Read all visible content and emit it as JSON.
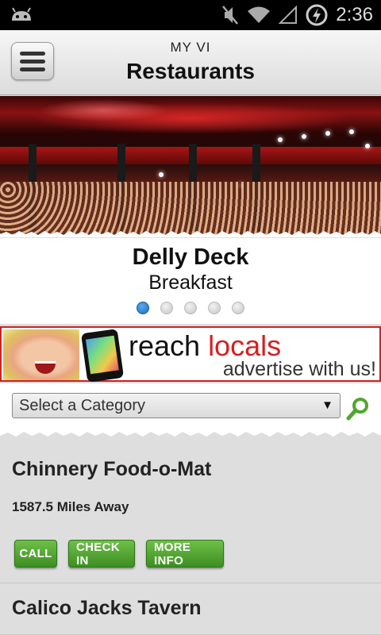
{
  "status_bar": {
    "time": "2:36"
  },
  "header": {
    "supertitle": "MY VI",
    "title": "Restaurants"
  },
  "slider": {
    "name": "Delly Deck",
    "category": "Breakfast",
    "slide_count": 5,
    "active_index": 0
  },
  "banner": {
    "reach": "reach ",
    "locals": "locals",
    "tagline": "advertise with us!"
  },
  "filter": {
    "select_value": "Select a Category"
  },
  "listings": [
    {
      "name": "Chinnery Food-o-Mat",
      "distance": "1587.5 Miles Away",
      "buttons": {
        "call": "CALL",
        "check_in": "CHECK IN",
        "more_info": "MORE INFO"
      }
    },
    {
      "name": "Calico Jacks Tavern"
    }
  ],
  "colors": {
    "accent_green": "#4fa72e",
    "banner_red": "#d42020",
    "dot_active": "#1b6fba"
  }
}
